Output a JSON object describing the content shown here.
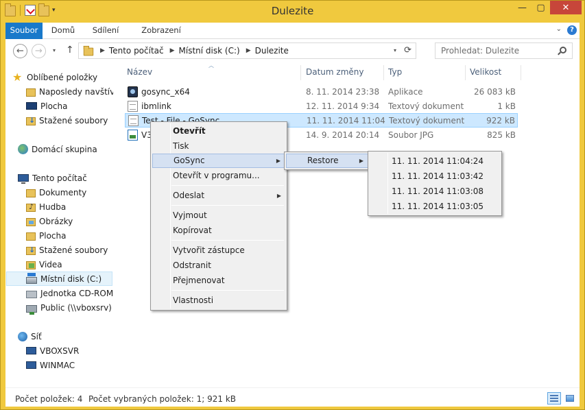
{
  "window": {
    "title": "Dulezite",
    "minimize_glyph": "—",
    "maximize_glyph": "▢",
    "close_glyph": "✕"
  },
  "ribbon": {
    "tabs": [
      "Soubor",
      "Domů",
      "Sdílení",
      "Zobrazení"
    ],
    "collapse_glyph": "⌄",
    "help_glyph": "?"
  },
  "address": {
    "back_glyph": "←",
    "forward_glyph": "→",
    "up_glyph": "↑",
    "crumbs": [
      "Tento počítač",
      "Místní disk (C:)",
      "Dulezite"
    ],
    "refresh_glyph": "⟳",
    "search_placeholder": "Prohledat: Dulezite"
  },
  "navigation": {
    "favorites": "Oblíbené položky",
    "favorites_items": [
      "Naposledy navštívené",
      "Plocha",
      "Stažené soubory"
    ],
    "homegroup": "Domácí skupina",
    "this_pc": "Tento počítač",
    "this_pc_items": [
      "Dokumenty",
      "Hudba",
      "Obrázky",
      "Plocha",
      "Stažené soubory",
      "Videa",
      "Místní disk (C:)",
      "Jednotka CD-ROM (D:)",
      "Public (\\\\vboxsrv) (E:)"
    ],
    "network": "Síť",
    "network_items": [
      "VBOXSVR",
      "WINMAC"
    ]
  },
  "columns": {
    "name": "Název",
    "date": "Datum změny",
    "type": "Typ",
    "size": "Velikost"
  },
  "files": [
    {
      "name": "gosync_x64",
      "date": "8. 11. 2014 23:38",
      "type": "Aplikace",
      "size": "26 083 kB",
      "icon": "application-icon"
    },
    {
      "name": "ibmlink",
      "date": "12. 11. 2014 9:34",
      "type": "Textový dokument",
      "size": "1 kB",
      "icon": "text-file-icon"
    },
    {
      "name": "Test - File - GoSync",
      "date": "11. 11. 2014 11:04",
      "type": "Textový dokument",
      "size": "922 kB",
      "icon": "text-file-icon"
    },
    {
      "name": "V3",
      "date": "14. 9. 2014 20:14",
      "type": "Soubor JPG",
      "size": "825 kB",
      "icon": "image-file-icon"
    }
  ],
  "context_menu": {
    "open": "Otevřít",
    "print": "Tisk",
    "gosync": "GoSync",
    "open_with": "Otevřít v programu...",
    "send_to": "Odeslat",
    "cut": "Vyjmout",
    "copy": "Kopírovat",
    "create_shortcut": "Vytvořit zástupce",
    "delete": "Odstranit",
    "rename": "Přejmenovat",
    "properties": "Vlastnosti"
  },
  "gosync_menu": {
    "restore": "Restore"
  },
  "restore_menu": {
    "timestamps": [
      "11. 11. 2014 11:04:24",
      "11. 11. 2014 11:03:42",
      "11. 11. 2014 11:03:08",
      "11. 11. 2014 11:03:05"
    ]
  },
  "status": {
    "item_count": "Počet položek: 4",
    "selected": "Počet vybraných položek: 1; 921 kB"
  }
}
